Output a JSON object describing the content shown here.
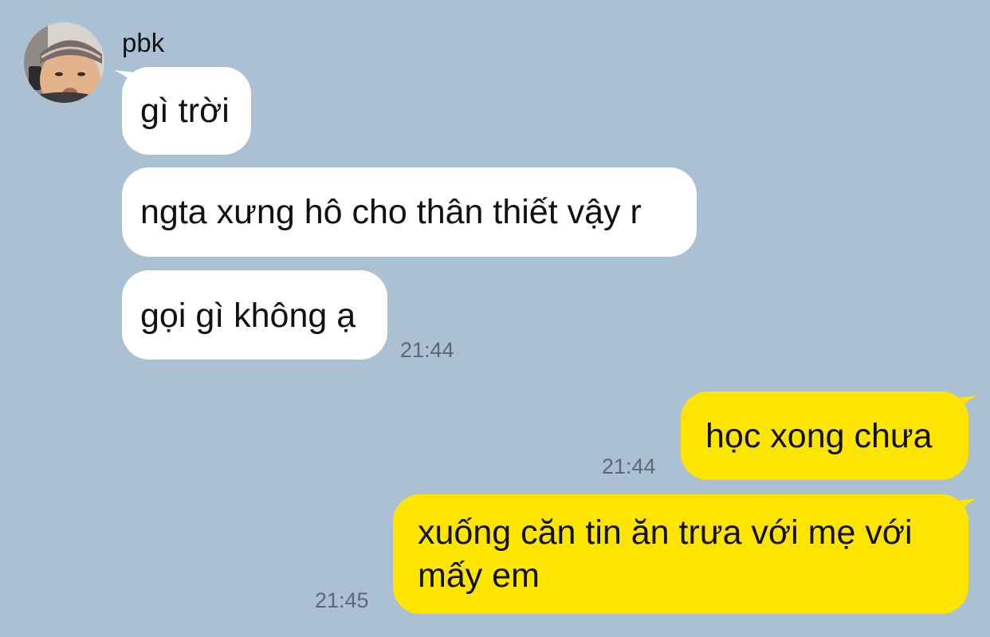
{
  "colors": {
    "background": "#abc1d3",
    "incoming_bubble": "#ffffff",
    "outgoing_bubble": "#fee500",
    "timestamp": "#5c6873"
  },
  "sender": {
    "name": "pbk",
    "avatar_icon": "profile-photo"
  },
  "incoming": [
    {
      "text": "gì trời"
    },
    {
      "text": "ngta xưng hô cho thân thiết vậy r"
    },
    {
      "text": "gọi gì không ạ",
      "time": "21:44"
    }
  ],
  "outgoing": [
    {
      "text": "học xong chưa",
      "time": "21:44"
    },
    {
      "text": "xuống căn tin ăn trưa với mẹ với mấy em",
      "time": "21:45"
    }
  ]
}
